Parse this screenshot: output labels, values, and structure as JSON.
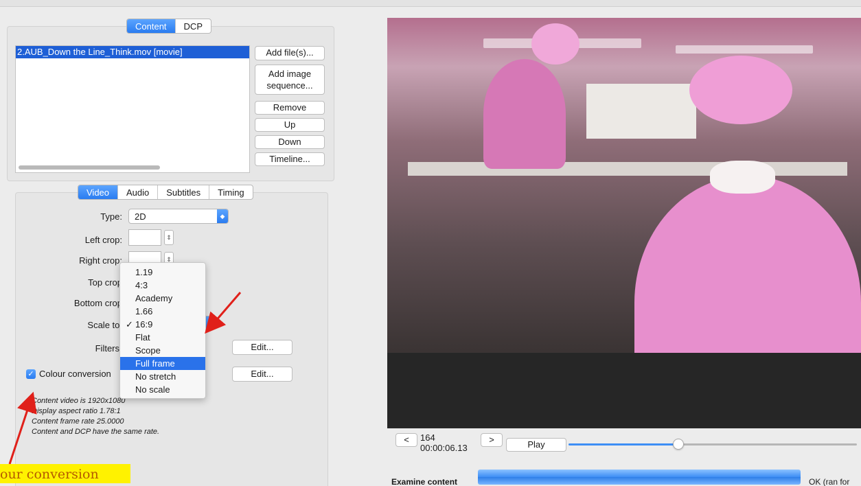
{
  "content_tabs": [
    {
      "label": "Content",
      "selected": true
    },
    {
      "label": "DCP",
      "selected": false
    }
  ],
  "file_list": {
    "items": [
      "2.AUB_Down the Line_Think.mov [movie]"
    ]
  },
  "file_buttons": {
    "add_files": "Add file(s)...",
    "add_image_line1": "Add image",
    "add_image_line2": "sequence...",
    "remove": "Remove",
    "up": "Up",
    "down": "Down",
    "timeline": "Timeline..."
  },
  "settings_tabs": [
    {
      "label": "Video",
      "selected": true
    },
    {
      "label": "Audio",
      "selected": false
    },
    {
      "label": "Subtitles",
      "selected": false
    },
    {
      "label": "Timing",
      "selected": false
    }
  ],
  "video_settings": {
    "type_label": "Type:",
    "type_value": "2D",
    "left_crop_label": "Left crop:",
    "right_crop_label": "Right crop:",
    "top_crop_label": "Top crop",
    "bottom_crop_label": "Bottom crop",
    "scale_to_label": "Scale to:",
    "filters_label": "Filters",
    "filters_edit": "Edit...",
    "colour_conversion_label": "Colour conversion",
    "colour_conversion_checked": true,
    "colour_conversion_edit": "Edit..."
  },
  "scale_dropdown": {
    "options": [
      "1.19",
      "4:3",
      "Academy",
      "1.66",
      "16:9",
      "Flat",
      "Scope",
      "Full frame",
      "No stretch",
      "No scale"
    ],
    "checked": "16:9",
    "highlighted": "Full frame",
    "check_mark": "✓"
  },
  "content_info": {
    "line1": "Content video is 1920x1080",
    "line2": "Display aspect ratio 1.78:1",
    "line3": "Content frame rate 25.0000",
    "line4": "Content and DCP have the same rate."
  },
  "annotation": {
    "text": "our conversion",
    "highlight_color": "#fff200",
    "arrow_color": "#e0201a"
  },
  "player": {
    "prev_button": "<",
    "next_button": ">",
    "frame_number": "164",
    "timecode": "00:00:06.13",
    "play_button": "Play",
    "slider_position": 0.38
  },
  "status_bar": {
    "examine_label": "Examine content",
    "progress": 1.0,
    "status_text": "OK (ran for"
  },
  "colors": {
    "accent": "#2a7cf0",
    "selection": "#1e5fd6"
  }
}
